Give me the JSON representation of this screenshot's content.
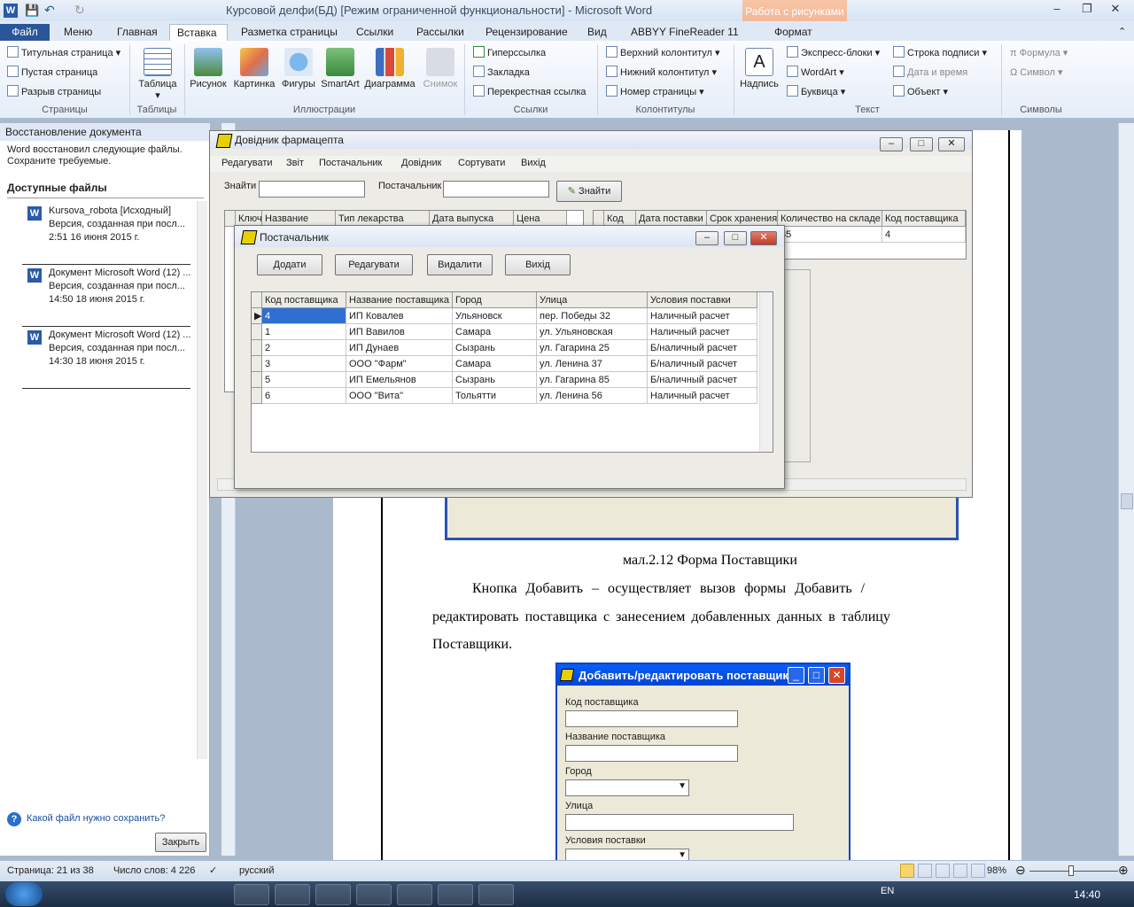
{
  "window_title": "Курсовой делфи(БД) [Режим ограниченной функциональности] - Microsoft Word",
  "context_tab_group": "Работа с рисунками",
  "tabs": [
    "Файл",
    "Меню",
    "Главная",
    "Вставка",
    "Разметка страницы",
    "Ссылки",
    "Рассылки",
    "Рецензирование",
    "Вид",
    "ABBYY FineReader 11",
    "Формат"
  ],
  "ribbon": {
    "pages": {
      "items": [
        "Титульная страница",
        "Пустая страница",
        "Разрыв страницы"
      ],
      "label": "Страницы"
    },
    "tables": {
      "button": "Таблица",
      "label": "Таблицы"
    },
    "illustrations": {
      "items": [
        "Рисунок",
        "Картинка",
        "Фигуры",
        "SmartArt",
        "Диаграмма",
        "Снимок"
      ],
      "label": "Иллюстрации"
    },
    "links": {
      "items": [
        "Гиперссылка",
        "Закладка",
        "Перекрестная ссылка"
      ],
      "label": "Ссылки"
    },
    "headers": {
      "items": [
        "Верхний колонтитул",
        "Нижний колонтитул",
        "Номер страницы"
      ],
      "label": "Колонтитулы"
    },
    "text": {
      "textbox": "Надпись",
      "items": [
        "Экспресс-блоки",
        "WordArt",
        "Буквица"
      ],
      "items2": [
        "Строка подписи",
        "Дата и время",
        "Объект"
      ],
      "label": "Текст"
    },
    "symbols": {
      "items": [
        "Формула",
        "Символ"
      ],
      "label": "Символы"
    }
  },
  "recovery": {
    "title": "Восстановление документа",
    "description": "Word восстановил следующие файлы. Сохраните требуемые.",
    "available": "Доступные файлы",
    "files": [
      {
        "name": "Kursova_robota  [Исходный]",
        "version": "Версия, созданная при посл...",
        "time": "2:51 16 июня 2015 г."
      },
      {
        "name": "Документ Microsoft Word (12) ...",
        "version": "Версия, созданная при посл...",
        "time": "14:50 18 июня 2015 г."
      },
      {
        "name": "Документ Microsoft Word (12) ...",
        "version": "Версия, созданная при посл...",
        "time": "14:30 18 июня 2015 г."
      }
    ],
    "help": "Какой файл нужно сохранить?",
    "close": "Закрыть"
  },
  "pharm": {
    "title": "Довідник фармацепта",
    "menu": [
      "Редагувати",
      "Звіт",
      "Постачальник",
      "Довідник",
      "Сортувати",
      "Вихід"
    ],
    "find_label": "Знайти",
    "supplier_label": "Постачальник",
    "find_button": "Знайти",
    "left_cols": [
      "Ключ",
      "Название",
      "Тип лекарства",
      "Дата выпуска",
      "Цена"
    ],
    "right_cols": [
      "Код",
      "Дата поставки",
      "Срок хранения",
      "Количество на складе",
      "Код поставщика"
    ],
    "right_row": [
      "",
      "",
      "",
      "35",
      "4"
    ]
  },
  "supplier": {
    "title": "Постачальник",
    "buttons": [
      "Додати",
      "Редагувати",
      "Видалити",
      "Вихід"
    ],
    "columns": [
      "Код поставщика",
      "Название поставщика",
      "Город",
      "Улица",
      "Условия поставки"
    ],
    "rows": [
      [
        "4",
        "ИП Ковалев",
        "Ульяновск",
        "пер. Победы 32",
        "Наличный расчет"
      ],
      [
        "1",
        "ИП Вавилов",
        "Самара",
        "ул. Ульяновская",
        "Наличный расчет"
      ],
      [
        "2",
        "ИП Дунаев",
        "Сызрань",
        "ул. Гагарина 25",
        "Б/наличный расчет"
      ],
      [
        "3",
        "ООО \"Фарм\"",
        "Самара",
        "ул. Ленина 37",
        "Б/наличный расчет"
      ],
      [
        "5",
        "ИП Емельянов",
        "Сызрань",
        "ул. Гагарина 85",
        "Б/наличный расчет"
      ],
      [
        "6",
        "ООО \"Вита\"",
        "Тольятти",
        " ул. Ленина 56",
        "Наличный расчет"
      ]
    ]
  },
  "document": {
    "caption": "мал.2.12 Форма Поставщики",
    "paragraph": [
      "Кнопка  Добавить  –  осуществляет  вызов  формы  Добавить  /",
      "редактировать  поставщика  с  занесением  добавленных  данных  в  таблицу",
      "Поставщики."
    ]
  },
  "edit_dialog": {
    "title": "Добавить/редактировать поставщика",
    "fields": [
      "Код поставщика",
      "Название поставщика",
      "Город",
      "Улица",
      "Условия поставки"
    ]
  },
  "status": {
    "page": "Страница: 21 из 38",
    "words": "Число слов: 4 226",
    "language": "русский",
    "zoom": "98%"
  },
  "taskbar": {
    "lang": "EN",
    "time": "14:40"
  }
}
